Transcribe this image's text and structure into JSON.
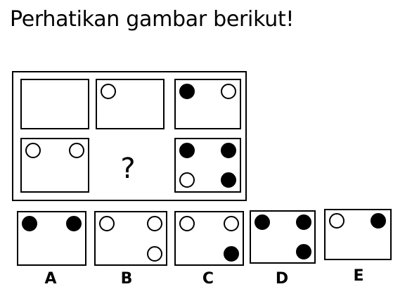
{
  "title": "Perhatikan gambar berikut!",
  "question_mark": "?",
  "options": {
    "a_label": "A",
    "b_label": "B",
    "c_label": "C",
    "d_label": "D",
    "e_label": "E"
  }
}
